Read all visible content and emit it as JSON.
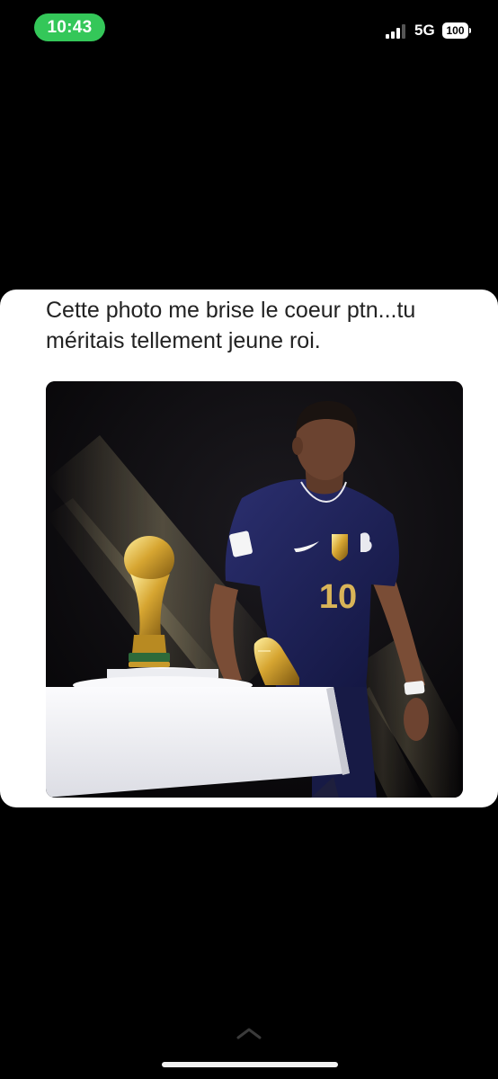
{
  "status_bar": {
    "time": "10:43",
    "network": "5G",
    "battery": "100",
    "time_pill_color": "#34c759",
    "signal_icon": "cellular-signal-icon",
    "battery_icon": "battery-icon"
  },
  "tweet": {
    "text": "Cette photo me brise le coeur ptn...tu méritais tellement jeune roi.",
    "image": {
      "shirt_number": "10"
    }
  },
  "bottom": {
    "chevron_icon": "chevron-up-icon"
  }
}
